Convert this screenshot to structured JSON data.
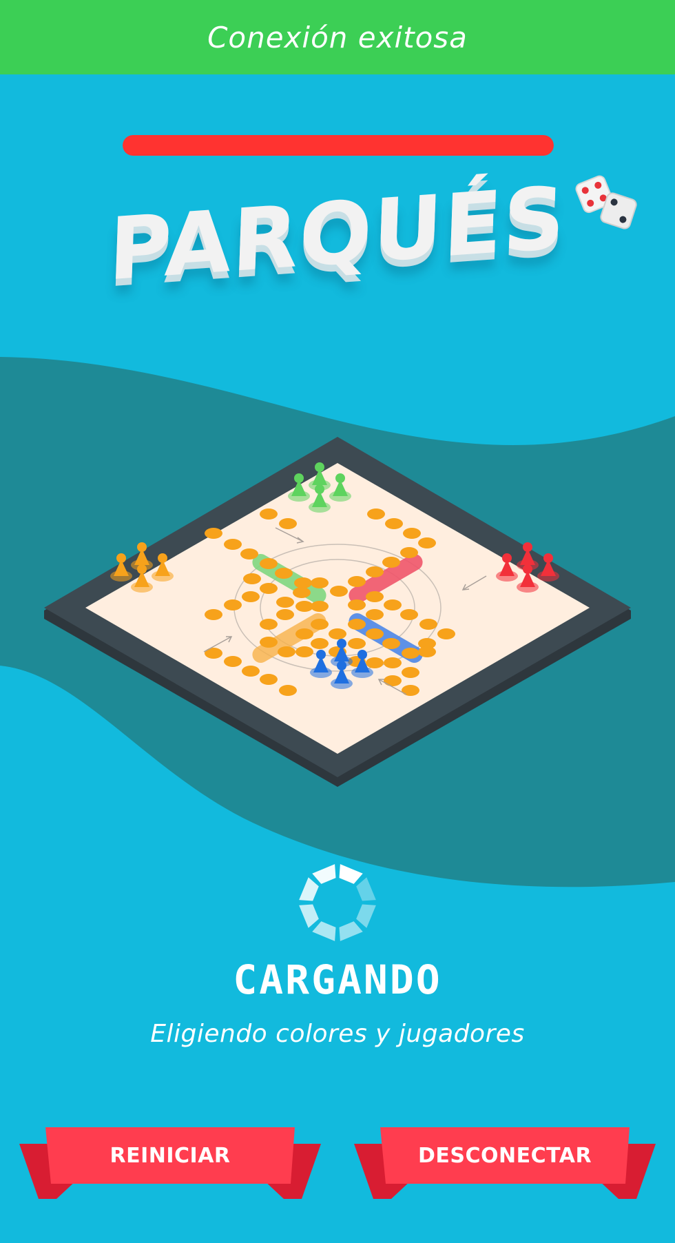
{
  "status": {
    "text": "Conexión exitosa",
    "color": "#3CCF55"
  },
  "progress": {
    "value": 1.0,
    "color": "#FF3330"
  },
  "title": {
    "text": "PARQUÉS"
  },
  "loading": {
    "title": "CARGANDO",
    "subtitle": "Eligiendo colores y jugadores",
    "icon": "spinner-icon"
  },
  "buttons": {
    "restart": {
      "label": "REINICIAR"
    },
    "disconnect": {
      "label": "DESCONECTAR"
    }
  },
  "colors": {
    "background": "#12BADD",
    "wave": "#1E8A96",
    "board_frame": "#3D4A52",
    "board_surface": "#FFEEDF",
    "ribbon": "#FF3D4F",
    "ribbon_fold": "#D81D32",
    "players": {
      "green": "#5ED35E",
      "orange": "#F7A21B",
      "red": "#F2303A",
      "blue": "#1F6FE0"
    }
  }
}
